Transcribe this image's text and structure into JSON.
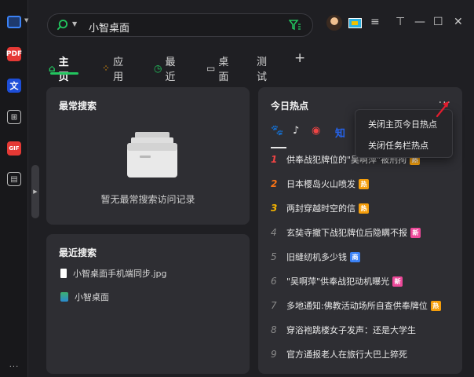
{
  "search": {
    "value": "小智桌面"
  },
  "tabs": [
    {
      "label": "主页",
      "icon": "home-icon"
    },
    {
      "label": "应用",
      "icon": "apps-icon"
    },
    {
      "label": "最近",
      "icon": "clock-icon"
    },
    {
      "label": "桌面",
      "icon": "monitor-icon"
    },
    {
      "label": "测试"
    },
    {
      "label": "+",
      "icon": "plus-icon"
    }
  ],
  "frequent": {
    "title": "最常搜索",
    "empty_text": "暂无最常搜索访问记录"
  },
  "recent": {
    "title": "最近搜索",
    "items": [
      {
        "label": "小智桌面手机端同步.jpg",
        "icon": "file-icon"
      },
      {
        "label": "小智桌面",
        "icon": "app-icon"
      }
    ]
  },
  "hot": {
    "title": "今日热点",
    "more": "···",
    "sources": [
      "baidu-paw-icon",
      "tiktok-icon",
      "weibo-icon",
      "知"
    ],
    "items": [
      {
        "rank": "1",
        "text": "供奉战犯牌位的\"吴啊萍\"被刑拘",
        "badge": "热",
        "badge_type": "hot"
      },
      {
        "rank": "2",
        "text": "日本樱岛火山喷发",
        "badge": "热",
        "badge_type": "hot"
      },
      {
        "rank": "3",
        "text": "两封穿越时空的信",
        "badge": "热",
        "badge_type": "hot"
      },
      {
        "rank": "4",
        "text": "玄奘寺撤下战犯牌位后隐瞒不报",
        "badge": "新",
        "badge_type": "new"
      },
      {
        "rank": "5",
        "text": "旧缝纫机多少钱",
        "badge": "商",
        "badge_type": "jian"
      },
      {
        "rank": "6",
        "text": "\"吴啊萍\"供奉战犯动机曝光",
        "badge": "新",
        "badge_type": "new"
      },
      {
        "rank": "7",
        "text": "多地通知:佛教活动场所自查供奉牌位",
        "badge": "热",
        "badge_type": "hot"
      },
      {
        "rank": "8",
        "text": "穿浴袍跳楼女子发声：还是大学生",
        "badge": "",
        "badge_type": ""
      },
      {
        "rank": "9",
        "text": "官方通报老人在旅行大巴上猝死",
        "badge": "",
        "badge_type": ""
      }
    ]
  },
  "menu": {
    "items": [
      "关闭主页今日热点",
      "关闭任务栏热点"
    ]
  },
  "window_controls": [
    "≡",
    "⊤",
    "—",
    "☐",
    "✕"
  ],
  "rail": {
    "items": [
      "PDF",
      "文",
      "⊞",
      "GIF",
      "▤"
    ],
    "more": "···"
  },
  "colors": {
    "accent": "#22c55e",
    "bg": "#1f1f23",
    "card": "#2e2e33",
    "rank1": "#ef4444",
    "rank2": "#f97316",
    "rank3": "#f5b400"
  }
}
